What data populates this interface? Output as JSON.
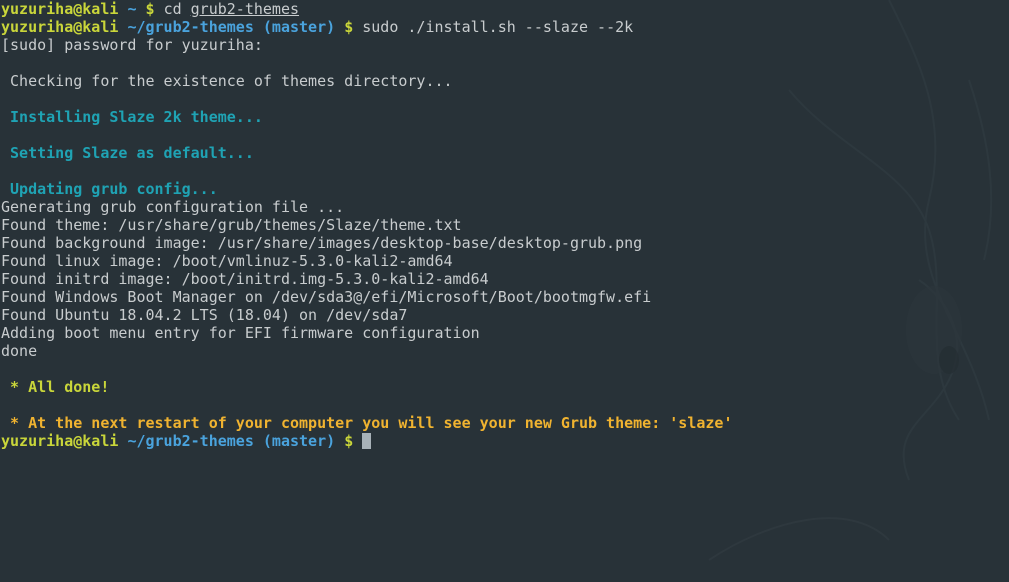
{
  "colors": {
    "background": "#283238",
    "user": "#c9d63a",
    "path": "#4aa3dd",
    "info": "#1fa3b4",
    "success": "#c9d63a",
    "notice": "#f0b330",
    "text": "#c8ccce"
  },
  "prompt": {
    "user_host": "yuzuriha@kali",
    "home_dir": "~",
    "repo_dir": "~/grub2-themes",
    "branch": "(master)",
    "symbol": "$"
  },
  "commands": {
    "cd": "cd",
    "cd_arg": "grub2-themes",
    "install": "sudo ./install.sh --slaze --2k"
  },
  "output": {
    "sudo_prompt": "[sudo] password for yuzuriha:",
    "checking": " Checking for the existence of themes directory...",
    "installing": " Installing Slaze 2k theme...",
    "setting_default": " Setting Slaze as default...",
    "updating_grub": " Updating grub config...",
    "generating": "Generating grub configuration file ...",
    "found_theme": "Found theme: /usr/share/grub/themes/Slaze/theme.txt",
    "found_background": "Found background image: /usr/share/images/desktop-base/desktop-grub.png",
    "found_linux": "Found linux image: /boot/vmlinuz-5.3.0-kali2-amd64",
    "found_initrd": "Found initrd image: /boot/initrd.img-5.3.0-kali2-amd64",
    "found_windows": "Found Windows Boot Manager on /dev/sda3@/efi/Microsoft/Boot/bootmgfw.efi",
    "found_ubuntu": "Found Ubuntu 18.04.2 LTS (18.04) on /dev/sda7",
    "adding_efi": "Adding boot menu entry for EFI firmware configuration",
    "done": "done",
    "all_done": " * All done!",
    "next_restart": " * At the next restart of your computer you will see your new Grub theme: 'slaze'"
  }
}
